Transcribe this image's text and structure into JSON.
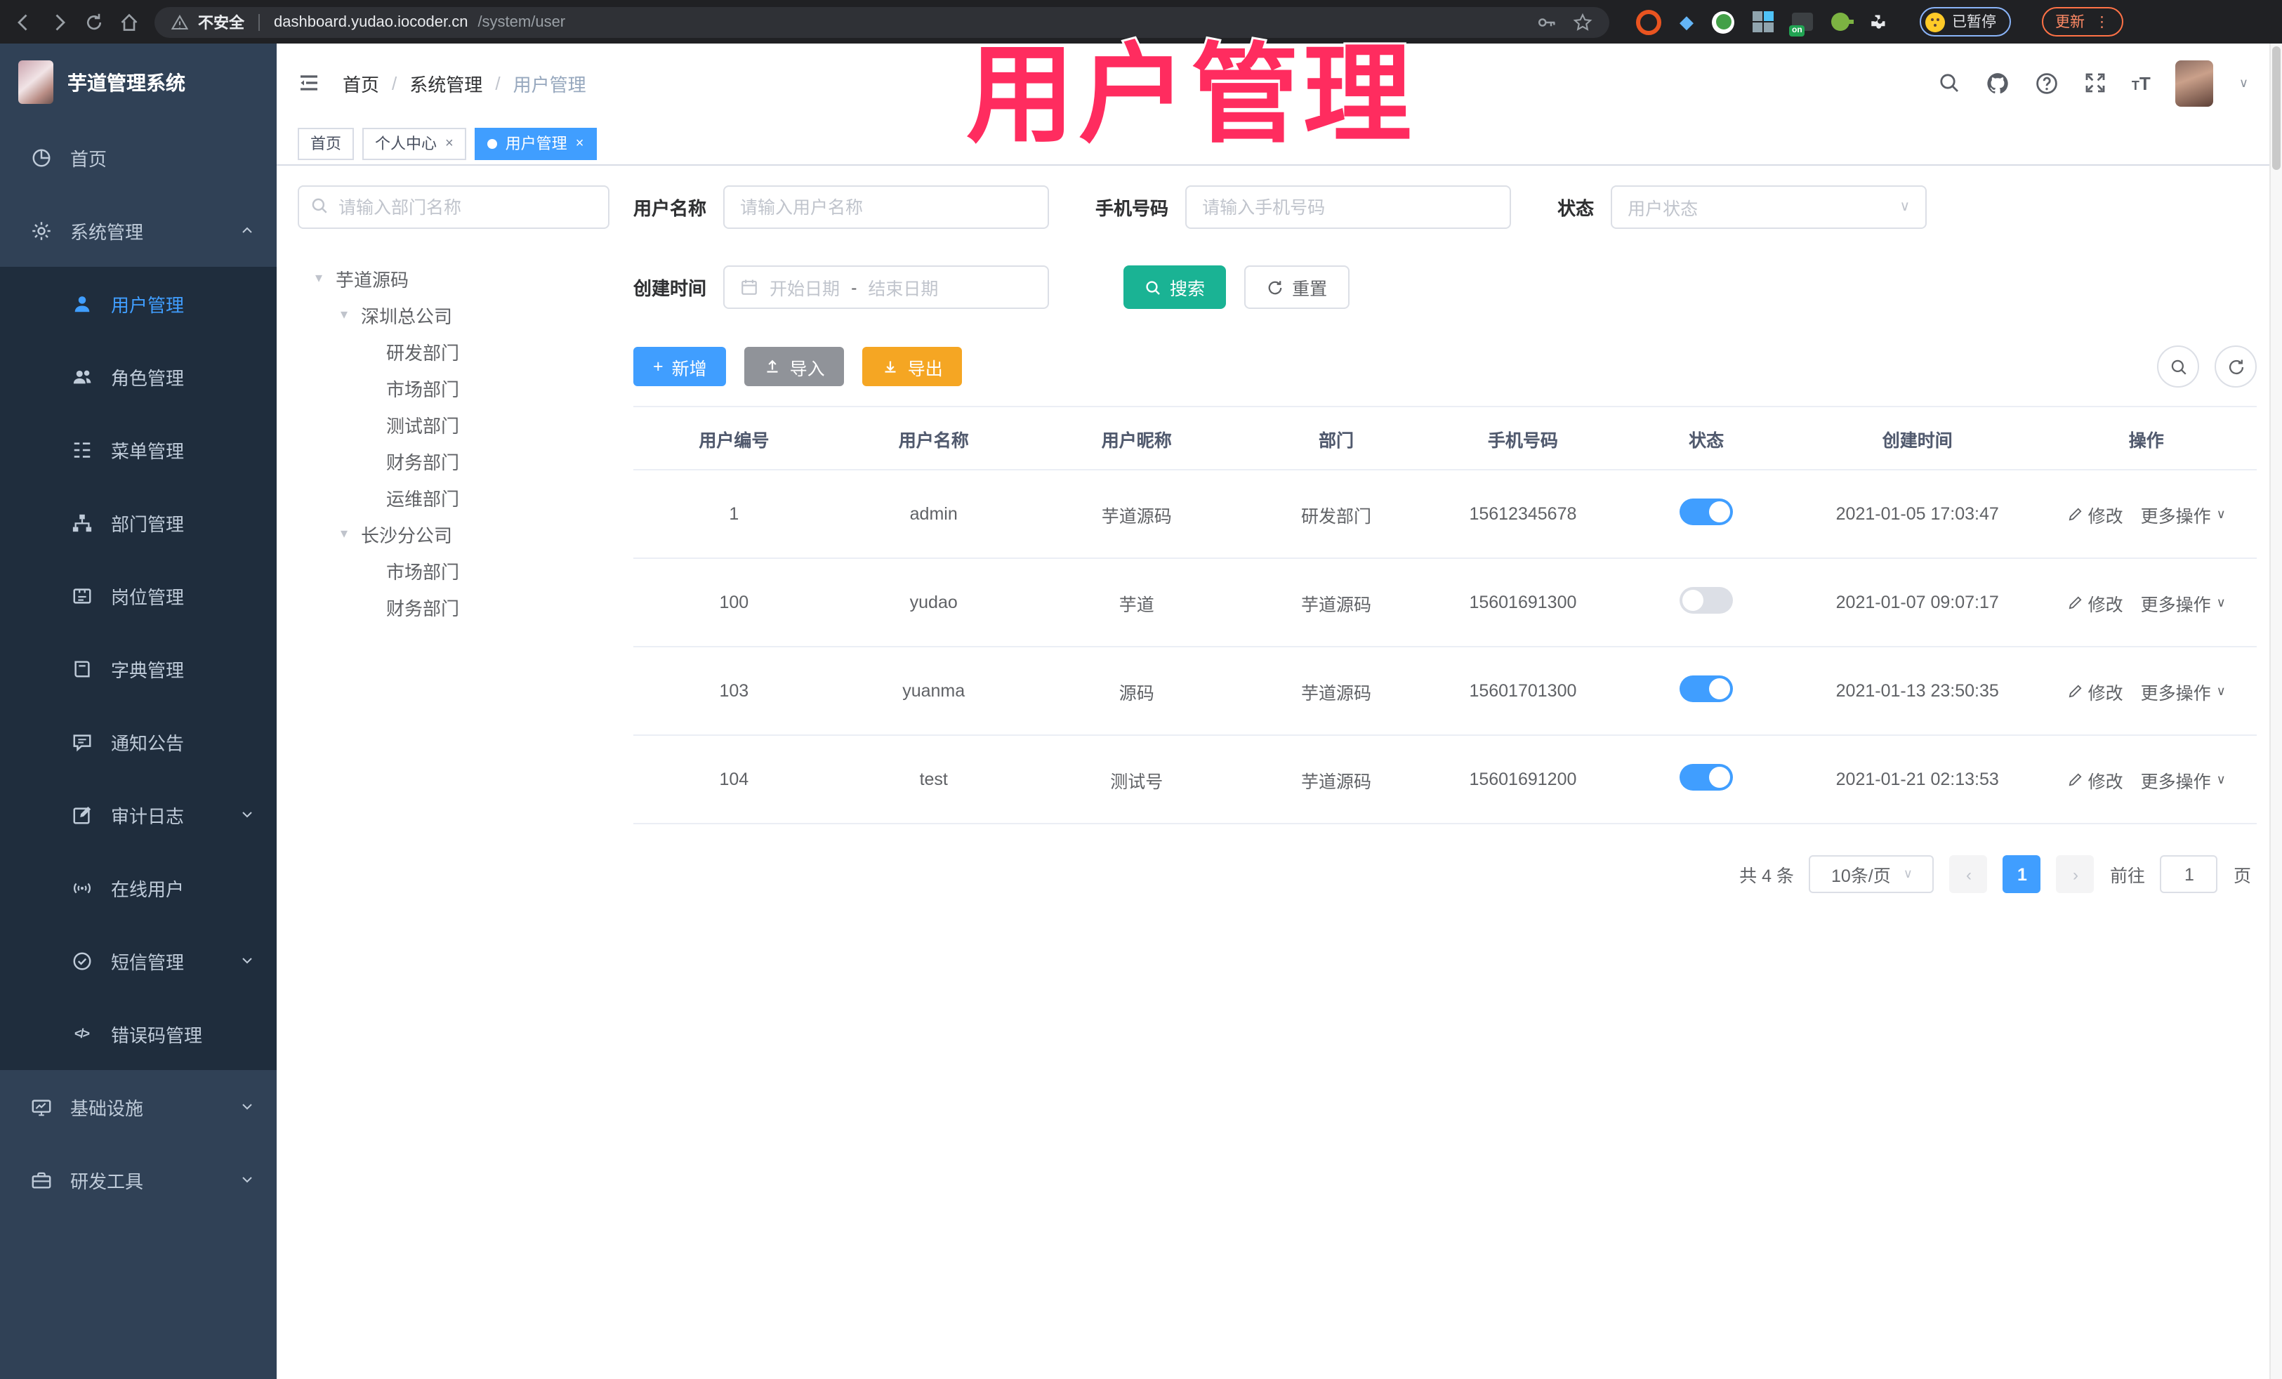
{
  "browser": {
    "security_label": "不安全",
    "url_host": "dashboard.yudao.iocoder.cn",
    "url_path": "/system/user",
    "extension_on_badge": "on",
    "paused_badge": "已暂停",
    "update_button": "更新"
  },
  "sidebar": {
    "app_title": "芋道管理系统",
    "items": [
      {
        "label": "首页"
      },
      {
        "label": "系统管理"
      },
      {
        "label": "基础设施"
      },
      {
        "label": "研发工具"
      }
    ],
    "system_submenu": [
      {
        "label": "用户管理"
      },
      {
        "label": "角色管理"
      },
      {
        "label": "菜单管理"
      },
      {
        "label": "部门管理"
      },
      {
        "label": "岗位管理"
      },
      {
        "label": "字典管理"
      },
      {
        "label": "通知公告"
      },
      {
        "label": "审计日志"
      },
      {
        "label": "在线用户"
      },
      {
        "label": "短信管理"
      },
      {
        "label": "错误码管理"
      }
    ]
  },
  "header": {
    "breadcrumb": [
      "首页",
      "系统管理",
      "用户管理"
    ]
  },
  "tabs": [
    {
      "label": "首页"
    },
    {
      "label": "个人中心"
    },
    {
      "label": "用户管理"
    }
  ],
  "dept_tree": {
    "search_placeholder": "请输入部门名称",
    "nodes": [
      {
        "label": "芋道源码"
      },
      {
        "label": "深圳总公司"
      },
      {
        "label": "研发部门"
      },
      {
        "label": "市场部门"
      },
      {
        "label": "测试部门"
      },
      {
        "label": "财务部门"
      },
      {
        "label": "运维部门"
      },
      {
        "label": "长沙分公司"
      },
      {
        "label": "市场部门"
      },
      {
        "label": "财务部门"
      }
    ]
  },
  "filters": {
    "username_label": "用户名称",
    "username_placeholder": "请输入用户名称",
    "mobile_label": "手机号码",
    "mobile_placeholder": "请输入手机号码",
    "status_label": "状态",
    "status_placeholder": "用户状态",
    "create_time_label": "创建时间",
    "date_start_placeholder": "开始日期",
    "date_separator": "-",
    "date_end_placeholder": "结束日期",
    "search_button": "搜索",
    "reset_button": "重置"
  },
  "toolbar": {
    "add": "新增",
    "import": "导入",
    "export": "导出"
  },
  "table": {
    "columns": [
      "用户编号",
      "用户名称",
      "用户昵称",
      "部门",
      "手机号码",
      "状态",
      "创建时间",
      "操作"
    ],
    "edit_label": "修改",
    "more_label": "更多操作",
    "rows": [
      {
        "id": "1",
        "username": "admin",
        "nickname": "芋道源码",
        "dept": "研发部门",
        "mobile": "15612345678",
        "status": true,
        "created": "2021-01-05 17:03:47"
      },
      {
        "id": "100",
        "username": "yudao",
        "nickname": "芋道",
        "dept": "芋道源码",
        "mobile": "15601691300",
        "status": false,
        "created": "2021-01-07 09:07:17"
      },
      {
        "id": "103",
        "username": "yuanma",
        "nickname": "源码",
        "dept": "芋道源码",
        "mobile": "15601701300",
        "status": true,
        "created": "2021-01-13 23:50:35"
      },
      {
        "id": "104",
        "username": "test",
        "nickname": "测试号",
        "dept": "芋道源码",
        "mobile": "15601691200",
        "status": true,
        "created": "2021-01-21 02:13:53"
      }
    ]
  },
  "pagination": {
    "total": "共 4 条",
    "page_size": "10条/页",
    "prev": "‹",
    "next": "›",
    "current_page": "1",
    "goto_label": "前往",
    "goto_value": "1",
    "page_unit": "页"
  },
  "overlay": {
    "title": "用户管理"
  },
  "glyphs": {
    "close": "×",
    "breadcrumb_separator": "/",
    "caret_down": "∨",
    "tree_caret": "▾",
    "plus": "+",
    "ellipsis_vertical": "⋮",
    "code": "</>",
    "gem": "◆"
  },
  "colors": {
    "primary": "#409EFF",
    "sidebar_bg": "#304156",
    "submenu_bg": "#1F2D3D",
    "search_button_teal": "#1AB394",
    "import_grey": "#909399",
    "export_orange": "#F5A623",
    "annotation_pink": "#FF2C5F",
    "switch_off": "#DCDFE6"
  }
}
